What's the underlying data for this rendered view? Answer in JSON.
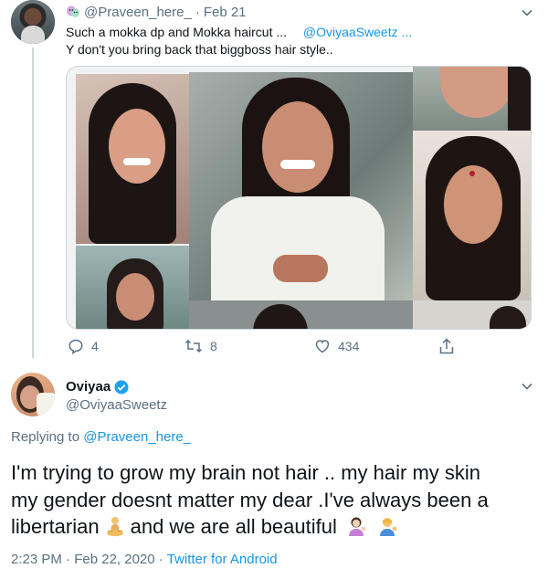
{
  "reply_tweet": {
    "handle": "@Praveen_here_",
    "separator": "·",
    "date": "Feb 21",
    "line1": "Such a mokka dp and Mokka haircut ...",
    "mention": "@OviyaaSweetz ...",
    "line2": "Y don't you bring back that biggboss hair style..",
    "stats": {
      "replies": "4",
      "retweets": "8",
      "likes": "434"
    },
    "icons": [
      "chevron-down-icon",
      "reply-icon",
      "retweet-icon",
      "like-icon",
      "share-icon"
    ]
  },
  "main_tweet": {
    "name": "Oviyaa",
    "verified": true,
    "handle": "@OviyaaSweetz",
    "replying_to_label": "Replying to",
    "replying_to_handle": "@Praveen_here_",
    "text_line1": "I'm trying to grow my brain not hair .. my hair my skin",
    "text_line2": "my gender doesnt matter my dear .I've always been a",
    "text_line3_a": "libertarian",
    "text_line3_b": "and we are all beautiful",
    "time": "2:23 PM",
    "dot": "·",
    "date": "Feb 22, 2020",
    "dot2": "·",
    "source": "Twitter for Android"
  },
  "colors": {
    "accent": "#1da1f2",
    "link": "#1b95e0",
    "muted": "#5b7083",
    "verified": "#1da1f2"
  }
}
